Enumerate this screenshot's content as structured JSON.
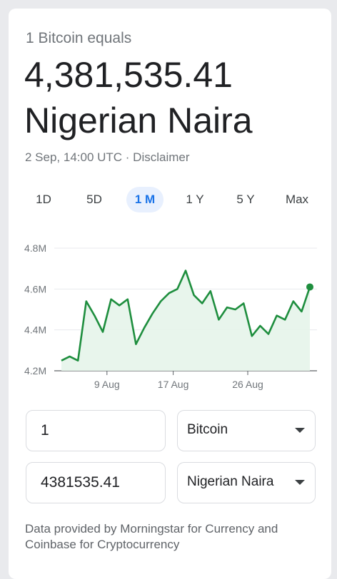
{
  "header": {
    "subtitle": "1 Bitcoin equals",
    "value": "4,381,535.41",
    "unit": "Nigerian Naira",
    "date_line": "2 Sep, 14:00 UTC · Disclaimer"
  },
  "tabs": [
    {
      "label": "1D",
      "active": false
    },
    {
      "label": "5D",
      "active": false
    },
    {
      "label": "1 M",
      "active": true
    },
    {
      "label": "1 Y",
      "active": false
    },
    {
      "label": "5 Y",
      "active": false
    },
    {
      "label": "Max",
      "active": false
    }
  ],
  "chart_data": {
    "type": "area",
    "ylim": [
      4.2,
      4.8
    ],
    "ytick_labels": [
      "4.2M",
      "4.4M",
      "4.6M",
      "4.8M"
    ],
    "yticks": [
      4.2,
      4.4,
      4.6,
      4.8
    ],
    "xtick_labels": [
      "9 Aug",
      "17 Aug",
      "26 Aug"
    ],
    "xtick_index": [
      5.5,
      13.5,
      22.5
    ],
    "values": [
      4.25,
      4.27,
      4.25,
      4.54,
      4.47,
      4.39,
      4.55,
      4.52,
      4.55,
      4.33,
      4.41,
      4.48,
      4.54,
      4.58,
      4.6,
      4.69,
      4.57,
      4.53,
      4.59,
      4.45,
      4.51,
      4.5,
      4.53,
      4.37,
      4.42,
      4.38,
      4.47,
      4.45,
      4.54,
      4.49,
      4.61
    ],
    "line_color": "#1e8e3e",
    "fill_color": "#e6f4ea",
    "grid": true
  },
  "converter": {
    "from_amount": "1",
    "from_currency": "Bitcoin",
    "to_amount": "4381535.41",
    "to_currency": "Nigerian Naira"
  },
  "footer": {
    "text": "Data provided by Morningstar for Currency and Coinbase for Cryptocurrency"
  }
}
